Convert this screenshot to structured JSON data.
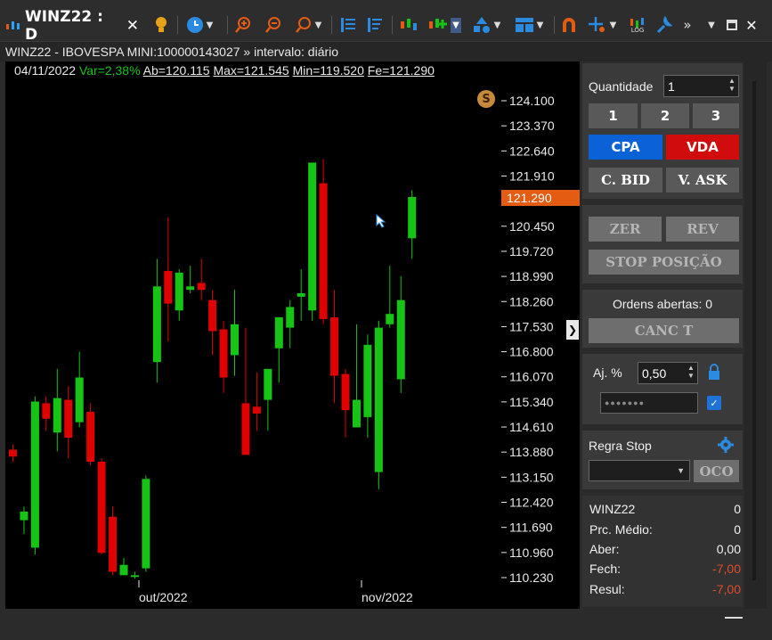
{
  "tab": {
    "title": "WINZ22 : D",
    "close": "✕"
  },
  "toolbar": {
    "icons": [
      "bulb-icon",
      "clock-icon",
      "zoom-in-icon",
      "zoom-out-icon",
      "zoom-icon",
      "indicators-icon",
      "studies-icon",
      "trade-icon",
      "add-order-icon",
      "shapes-icon",
      "layout-icon",
      "magnet-icon",
      "crosshair-icon",
      "log-scale-icon",
      "wrench-icon"
    ],
    "log_label": "LOG",
    "more": "»"
  },
  "info": {
    "text": "WINZ22 - IBOVESPA MINI:100000143027 » intervalo: diário"
  },
  "ohlc": {
    "date": "04/11/2022",
    "var": "Var=2,38%",
    "ab": "Ab=120.115",
    "max": "Max=121.545",
    "min": "Min=119.520",
    "fe": "Fe=121.290"
  },
  "chart": {
    "badge": "S",
    "price_tag": "121.290",
    "yticks": [
      "124.100",
      "123.370",
      "122.640",
      "121.910",
      "120.450",
      "119.720",
      "118.990",
      "118.260",
      "117.530",
      "116.800",
      "116.070",
      "115.340",
      "114.610",
      "113.880",
      "113.150",
      "112.420",
      "111.690",
      "110.960",
      "110.230"
    ],
    "xticks": [
      "out/2022",
      "nov/2022"
    ],
    "collapse_arrow": "❯"
  },
  "colors": {
    "up": "#16c416",
    "down": "#e00000",
    "accent": "#e45b12",
    "buy": "#0a62d6",
    "sell": "#d10c0c"
  },
  "chart_data": {
    "type": "candlestick",
    "ylim": [
      110.23,
      124.1
    ],
    "candles": [
      {
        "o": 113.95,
        "h": 114.1,
        "l": 113.6,
        "c": 113.75
      },
      {
        "o": 111.9,
        "h": 112.3,
        "l": 111.5,
        "c": 112.15
      },
      {
        "o": 111.1,
        "h": 115.5,
        "l": 110.9,
        "c": 115.35
      },
      {
        "o": 115.3,
        "h": 115.5,
        "l": 114.5,
        "c": 114.85
      },
      {
        "o": 114.45,
        "h": 116.3,
        "l": 113.9,
        "c": 115.45
      },
      {
        "o": 115.4,
        "h": 115.8,
        "l": 113.7,
        "c": 114.3
      },
      {
        "o": 114.75,
        "h": 116.8,
        "l": 114.6,
        "c": 116.05
      },
      {
        "o": 115.05,
        "h": 115.3,
        "l": 113.5,
        "c": 113.6
      },
      {
        "o": 113.6,
        "h": 113.7,
        "l": 110.9,
        "c": 110.95
      },
      {
        "o": 112.0,
        "h": 112.3,
        "l": 110.3,
        "c": 110.4
      },
      {
        "o": 110.3,
        "h": 110.8,
        "l": 110.3,
        "c": 110.6
      },
      {
        "o": 110.25,
        "h": 110.4,
        "l": 110.2,
        "c": 110.3
      },
      {
        "o": 110.5,
        "h": 113.2,
        "l": 110.4,
        "c": 113.1
      },
      {
        "o": 116.5,
        "h": 119.5,
        "l": 115.9,
        "c": 118.7
      },
      {
        "o": 119.15,
        "h": 120.7,
        "l": 117.1,
        "c": 118.2
      },
      {
        "o": 118.0,
        "h": 119.2,
        "l": 117.7,
        "c": 119.1
      },
      {
        "o": 118.6,
        "h": 119.3,
        "l": 118.5,
        "c": 118.7
      },
      {
        "o": 118.8,
        "h": 119.5,
        "l": 118.3,
        "c": 118.6
      },
      {
        "o": 118.3,
        "h": 118.6,
        "l": 116.7,
        "c": 117.4
      },
      {
        "o": 117.45,
        "h": 117.7,
        "l": 115.6,
        "c": 116.05
      },
      {
        "o": 116.7,
        "h": 118.6,
        "l": 116.1,
        "c": 117.6
      },
      {
        "o": 115.3,
        "h": 117.5,
        "l": 113.9,
        "c": 113.8
      },
      {
        "o": 115.2,
        "h": 116.2,
        "l": 114.5,
        "c": 115.0
      },
      {
        "o": 115.4,
        "h": 116.3,
        "l": 114.5,
        "c": 116.3
      },
      {
        "o": 116.9,
        "h": 117.7,
        "l": 115.9,
        "c": 117.8
      },
      {
        "o": 117.5,
        "h": 118.3,
        "l": 116.9,
        "c": 118.1
      },
      {
        "o": 118.4,
        "h": 119.2,
        "l": 117.7,
        "c": 118.5
      },
      {
        "o": 118.0,
        "h": 122.2,
        "l": 117.7,
        "c": 122.3
      },
      {
        "o": 121.7,
        "h": 122.4,
        "l": 117.6,
        "c": 117.75
      },
      {
        "o": 117.8,
        "h": 118.6,
        "l": 115.3,
        "c": 116.1
      },
      {
        "o": 116.15,
        "h": 116.3,
        "l": 114.3,
        "c": 115.1
      },
      {
        "o": 114.6,
        "h": 117.6,
        "l": 114.6,
        "c": 115.4
      },
      {
        "o": 114.9,
        "h": 117.3,
        "l": 114.3,
        "c": 117.0
      },
      {
        "o": 113.3,
        "h": 117.7,
        "l": 112.8,
        "c": 117.5
      },
      {
        "o": 117.6,
        "h": 119.3,
        "l": 117.5,
        "c": 117.9
      },
      {
        "o": 116.0,
        "h": 119.0,
        "l": 115.6,
        "c": 118.3
      },
      {
        "o": 120.1,
        "h": 121.5,
        "l": 119.5,
        "c": 121.3
      }
    ]
  },
  "panel": {
    "quantidade_label": "Quantidade",
    "quantidade_value": "1",
    "qty_buttons": [
      "1",
      "2",
      "3"
    ],
    "cpa": "CPA",
    "vda": "VDA",
    "cbid": "C. BID",
    "vask": "V. ASK",
    "zer": "ZER",
    "rev": "REV",
    "stop_posicao": "STOP POSIÇÃO",
    "ordens_abertas": "Ordens abertas: 0",
    "canc_t": "CANC T",
    "aj_label": "Aj. %",
    "aj_value": "0,50",
    "password_mask": "●●●●●●●",
    "regra_stop_label": "Regra Stop",
    "oco": "OCO",
    "position": {
      "symbol": "WINZ22",
      "symbol_val": "0",
      "prc_medio": "Prc. Médio:",
      "prc_medio_val": "0",
      "aber": "Aber:",
      "aber_val": "0,00",
      "fech": "Fech:",
      "fech_val": "-7,00",
      "resul": "Resul:",
      "resul_val": "-7,00"
    }
  }
}
